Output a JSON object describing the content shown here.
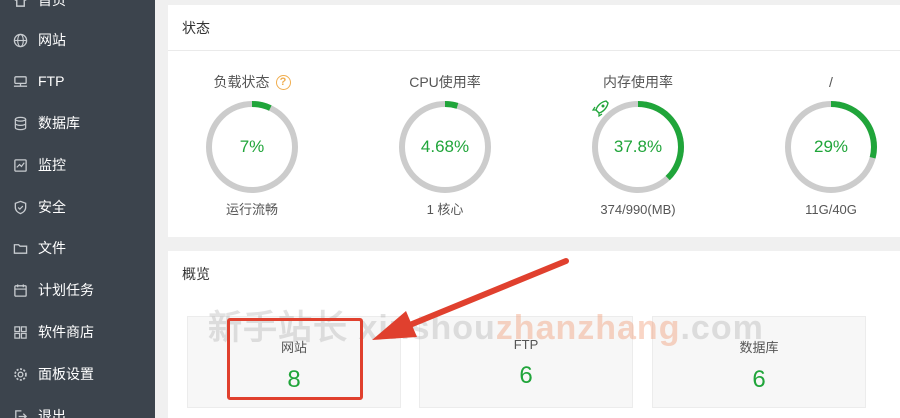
{
  "colors": {
    "sidebar_bg": "#3c444d",
    "accent_green": "#20a53a",
    "ring_track": "#cccccc",
    "annotation_red": "#e0402e",
    "help_orange": "#f0ad4e"
  },
  "sidebar": {
    "items": [
      {
        "label": "首页",
        "icon": "home-icon"
      },
      {
        "label": "网站",
        "icon": "globe-icon"
      },
      {
        "label": "FTP",
        "icon": "ftp-icon"
      },
      {
        "label": "数据库",
        "icon": "database-icon"
      },
      {
        "label": "监控",
        "icon": "monitor-icon"
      },
      {
        "label": "安全",
        "icon": "shield-icon"
      },
      {
        "label": "文件",
        "icon": "folder-icon"
      },
      {
        "label": "计划任务",
        "icon": "calendar-icon"
      },
      {
        "label": "软件商店",
        "icon": "apps-grid-icon"
      },
      {
        "label": "面板设置",
        "icon": "gear-icon"
      },
      {
        "label": "退出",
        "icon": "logout-icon"
      }
    ]
  },
  "status": {
    "title": "状态",
    "gauges": [
      {
        "label": "负载状态",
        "value": "7%",
        "percent": 7,
        "sub": "运行流畅"
      },
      {
        "label": "CPU使用率",
        "value": "4.68%",
        "percent": 4.68,
        "sub": "1 核心"
      },
      {
        "label": "内存使用率",
        "value": "37.8%",
        "percent": 37.8,
        "sub": "374/990(MB)"
      },
      {
        "label": "/",
        "value": "29%",
        "percent": 29,
        "sub": "11G/40G"
      }
    ]
  },
  "overview": {
    "title": "概览",
    "cards": [
      {
        "label": "网站",
        "value": "8"
      },
      {
        "label": "FTP",
        "value": "6"
      },
      {
        "label": "数据库",
        "value": "6"
      }
    ]
  },
  "watermark": {
    "main": "新手站长 xinshou",
    "accent": "zhanzhang",
    "tail": ".com"
  }
}
